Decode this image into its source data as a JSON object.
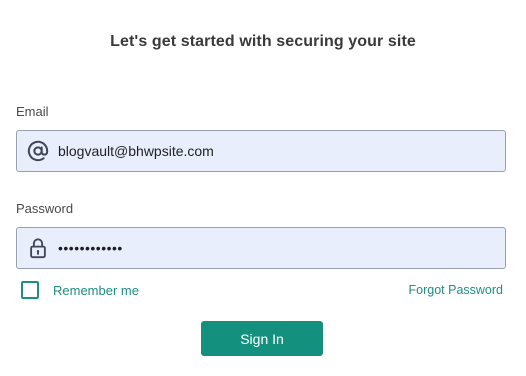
{
  "page": {
    "title": "Let's get started with securing your site"
  },
  "form": {
    "email": {
      "label": "Email",
      "value": "blogvault@bhwpsite.com",
      "icon": "at-sign-icon"
    },
    "password": {
      "label": "Password",
      "value": "••••••••••••",
      "icon": "lock-icon"
    },
    "remember_me": {
      "label": "Remember me",
      "checked": false
    },
    "forgot_password_label": "Forgot Password",
    "submit_label": "Sign In"
  },
  "colors": {
    "accent": "#14917e",
    "link": "#1f8f80",
    "input_background": "#e8eefc",
    "input_border": "#9aa0aa"
  }
}
